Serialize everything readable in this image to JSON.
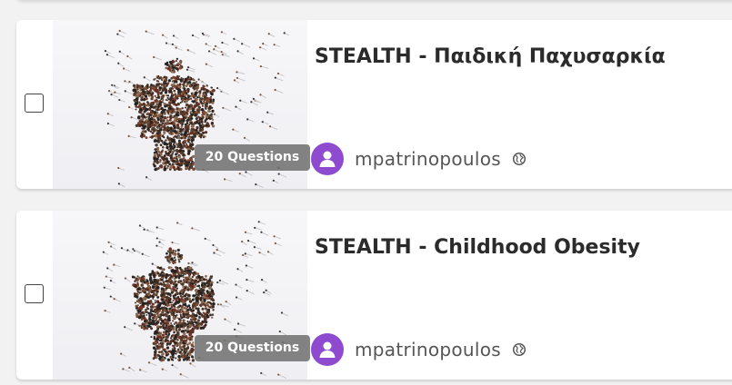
{
  "quizzes": [
    {
      "title": "STEALTH - Παιδική Παχυσαρκία",
      "questions_label": "20 Questions",
      "author": "mpatrinopoulos"
    },
    {
      "title": "STEALTH - Childhood Obesity",
      "questions_label": "20 Questions",
      "author": "mpatrinopoulos"
    }
  ],
  "colors": {
    "avatar": "#8e4bd0",
    "title": "#2b2b2b",
    "author": "#555555",
    "badge_bg": "#6e6e6e"
  },
  "icons": [
    "user-icon",
    "globe-icon",
    "crowd-figure-thumbnail"
  ]
}
